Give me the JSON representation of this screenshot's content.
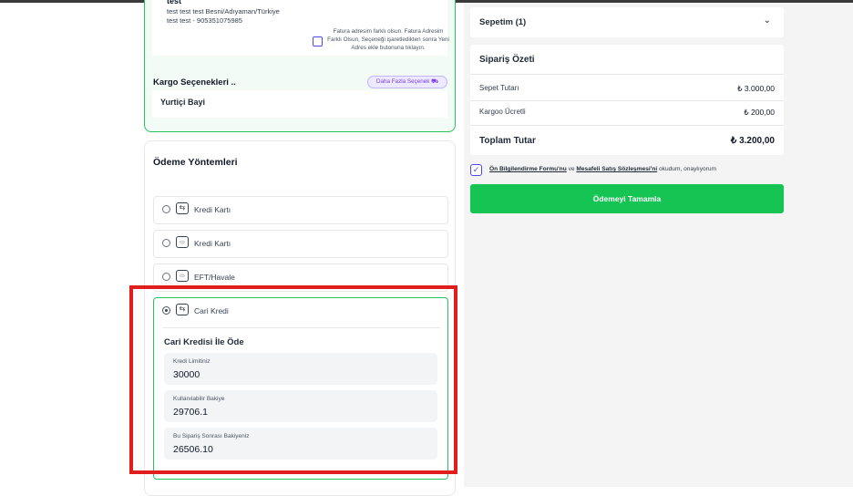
{
  "address": {
    "name": "test",
    "line1": "test test test Besni/Adıyaman/Türkiye",
    "line2": "test test - 905351075985",
    "billing_note": "Fatura adresim farklı olsun. Fatura Adresim Farklı Olsun, Seçeneği işaretledikten sonra Yeni Adres ekle butonuna tıklayın."
  },
  "cargo": {
    "title": "Kargo Seçenekleri ..",
    "more_options": "Daha Fazla Seçenek",
    "selected": "Yurtiçi Bayi"
  },
  "payment": {
    "title": "Ödeme Yöntemleri",
    "options": [
      {
        "label": "Kredi Kartı",
        "icon": "transfer-icon"
      },
      {
        "label": "Kredi Kartı",
        "icon": "credit-card-icon"
      },
      {
        "label": "EFT/Havale",
        "icon": "credit-card-icon"
      },
      {
        "label": "Cari Kredi",
        "icon": "transfer-icon",
        "selected": true
      }
    ],
    "credit": {
      "title": "Cari Kredisi İle Öde",
      "fields": [
        {
          "label": "Kredi Limitiniz",
          "value": "30000"
        },
        {
          "label": "Kullanılabilir Bakiye",
          "value": "29706.1"
        },
        {
          "label": "Bu Sipariş Sonrası Bakiyeniz",
          "value": "26506.10"
        }
      ]
    }
  },
  "cart": {
    "title": "Sepetim (1)"
  },
  "summary": {
    "title": "Sipariş Özeti",
    "rows": [
      {
        "label": "Sepet Tutarı",
        "value": "₺ 3.000,00"
      },
      {
        "label": "Kargoo Ücretli",
        "value": "₺ 200,00"
      }
    ],
    "total_label": "Toplam Tutar",
    "total_value": "₺ 3.200,00"
  },
  "terms": {
    "link1": "Ön Bilgilendirme Formu'nu",
    "and": " ve ",
    "link2": "Mesafeli Satış Sözleşmesi'ni",
    "suffix": " okudum, onaylıyorum"
  },
  "pay_button": "Ödemeyi Tamamla",
  "colors": {
    "accent_green": "#16c453",
    "highlight_red": "#e11d1d"
  }
}
